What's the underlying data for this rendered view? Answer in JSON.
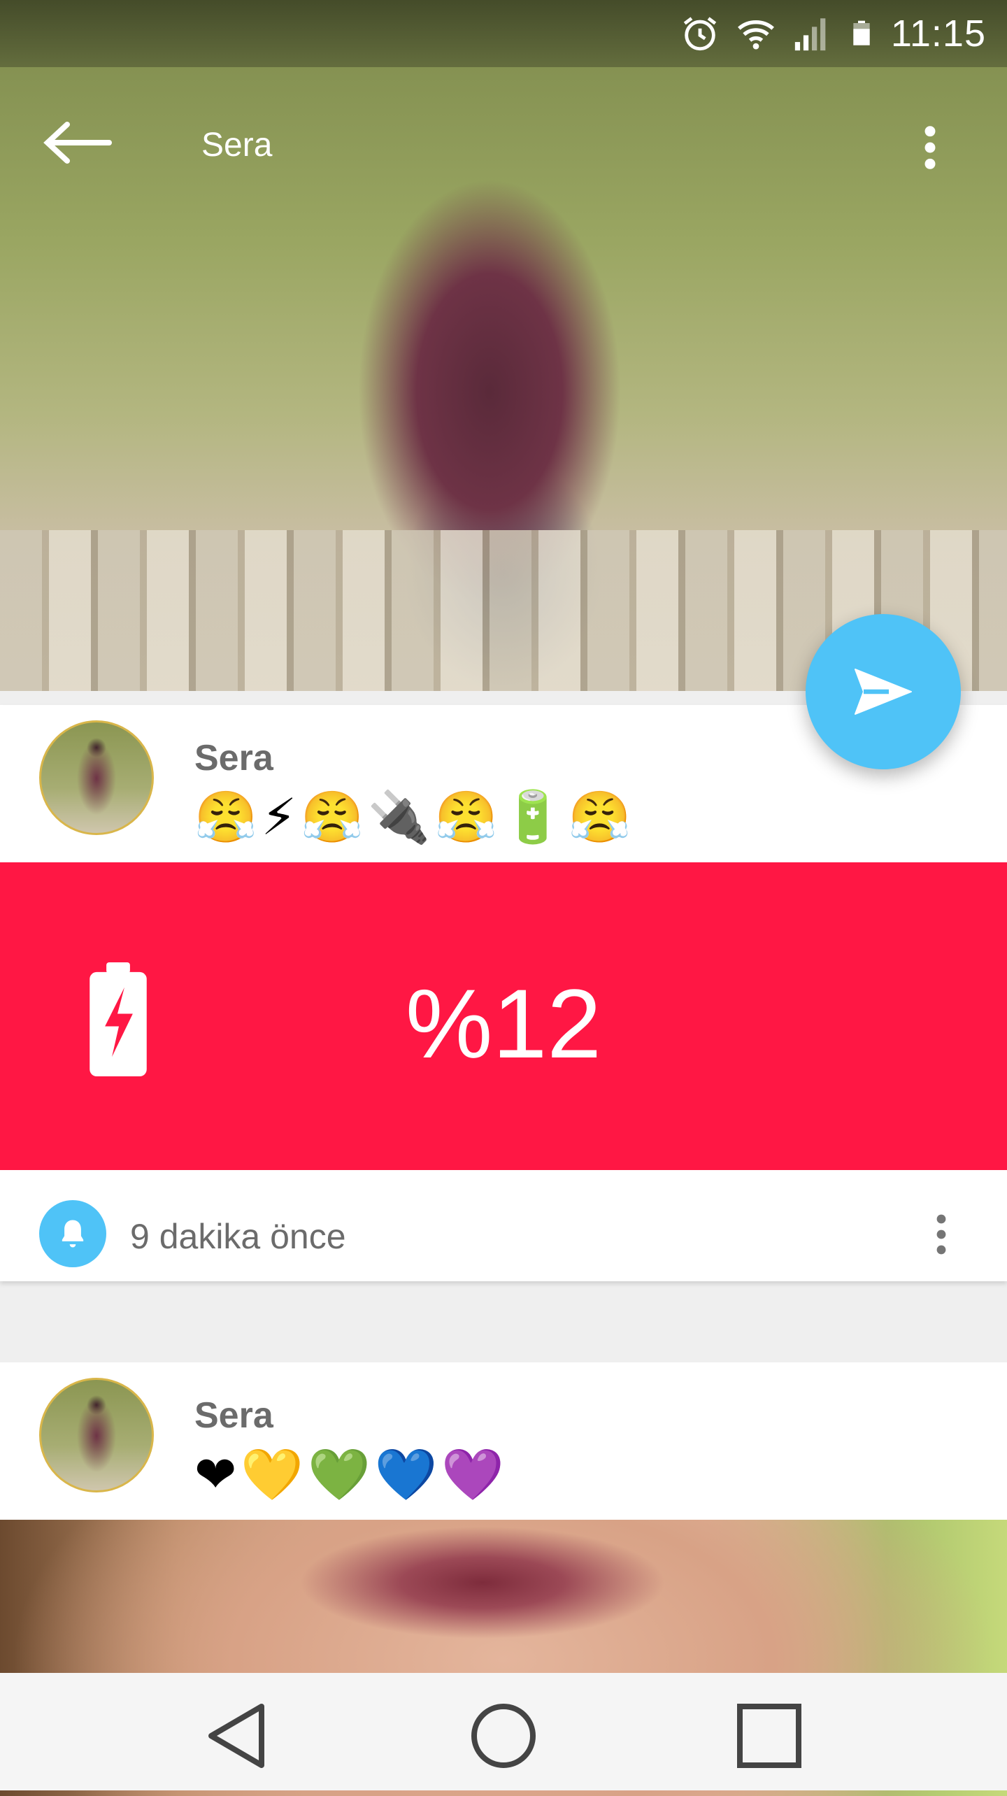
{
  "status_bar": {
    "time": "11:15",
    "icons": [
      "alarm-icon",
      "wifi-icon",
      "signal-icon",
      "battery-icon"
    ]
  },
  "toolbar": {
    "title": "Sera",
    "back_icon": "arrow-back-icon",
    "overflow_icon": "more-vert-icon"
  },
  "fab": {
    "icon": "send-icon",
    "color": "#4fc3f7"
  },
  "posts": [
    {
      "author": "Sera",
      "emoji_text": "😤⚡😤🔌😤🔋😤",
      "battery": {
        "value": "%12",
        "icon": "battery-charging-icon",
        "banner_color": "#ff1744"
      },
      "time": "9 dakika önce",
      "footer_icon": "bell-icon"
    },
    {
      "author": "Sera",
      "emoji_text": "❤💛💚💙💜"
    }
  ],
  "nav_bar": {
    "icons": [
      "back-triangle-icon",
      "home-circle-icon",
      "recents-square-icon"
    ]
  }
}
